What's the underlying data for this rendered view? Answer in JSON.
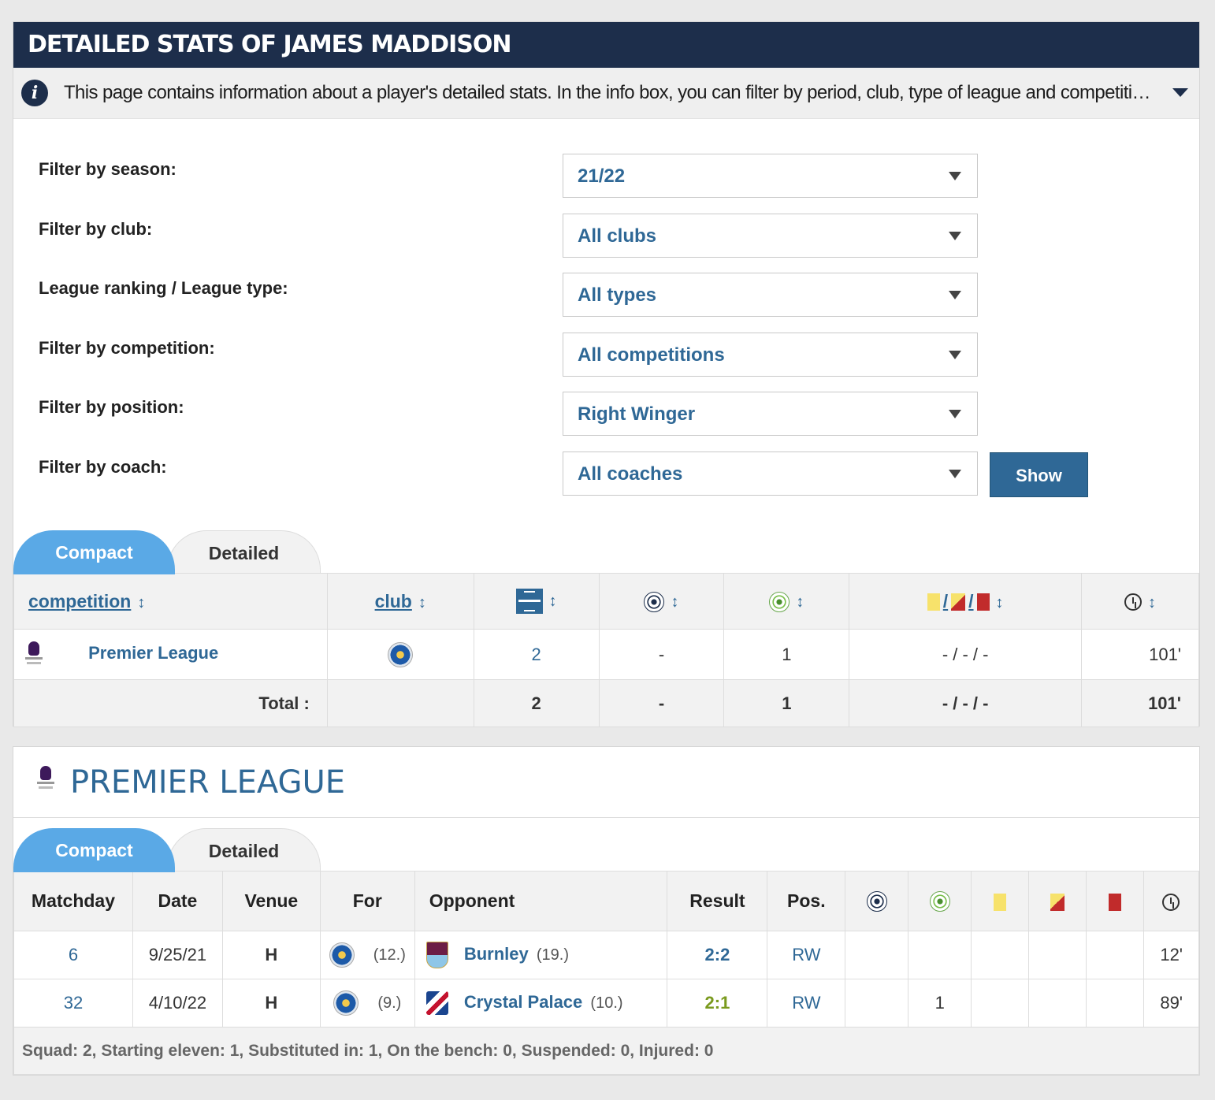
{
  "header": {
    "title": "DETAILED STATS OF JAMES MADDISON"
  },
  "info": {
    "text": "This page contains information about a player's detailed stats. In the info box, you can filter by period, club, type of league and competition. Th..."
  },
  "filters": [
    {
      "label": "Filter by season:",
      "value": "21/22"
    },
    {
      "label": "Filter by club:",
      "value": "All clubs"
    },
    {
      "label": "League ranking / League type:",
      "value": "All types"
    },
    {
      "label": "Filter by competition:",
      "value": "All competitions"
    },
    {
      "label": "Filter by position:",
      "value": "Right Winger"
    },
    {
      "label": "Filter by coach:",
      "value": "All coaches"
    }
  ],
  "show_button": "Show",
  "tabs": {
    "compact": "Compact",
    "detailed": "Detailed"
  },
  "summary_table": {
    "headers": {
      "competition": "competition",
      "club": "club",
      "sort": "↕"
    },
    "row": {
      "competition": "Premier League",
      "apps": "2",
      "goals": "-",
      "assists": "1",
      "cards": "- / - / -",
      "minutes": "101'"
    },
    "total": {
      "label": "Total :",
      "apps": "2",
      "goals": "-",
      "assists": "1",
      "cards": "- / - / -",
      "minutes": "101'"
    }
  },
  "section": {
    "title": "PREMIER LEAGUE"
  },
  "match_table": {
    "headers": {
      "matchday": "Matchday",
      "date": "Date",
      "venue": "Venue",
      "for": "For",
      "opponent": "Opponent",
      "result": "Result",
      "pos": "Pos."
    },
    "rows": [
      {
        "matchday": "6",
        "date": "9/25/21",
        "venue": "H",
        "for_rank": "(12.)",
        "opponent": "Burnley",
        "opp_rank": "(19.)",
        "result": "2:2",
        "pos": "RW",
        "goals": "",
        "assists": "",
        "yellow": "",
        "yellowred": "",
        "red": "",
        "minutes": "12'"
      },
      {
        "matchday": "32",
        "date": "4/10/22",
        "venue": "H",
        "for_rank": "(9.)",
        "opponent": "Crystal Palace",
        "opp_rank": "(10.)",
        "result": "2:1",
        "pos": "RW",
        "goals": "",
        "assists": "1",
        "yellow": "",
        "yellowred": "",
        "red": "",
        "minutes": "89'"
      }
    ],
    "footer": "Squad: 2, Starting eleven: 1, Substituted in: 1, On the bench: 0, Suspended: 0, Injured: 0"
  },
  "colors": {
    "header_bg": "#1d2e4b",
    "accent": "#2f6896",
    "tab_active": "#5aa9e6",
    "draw_result": "#2f6896",
    "win_result": "#7a9a1e"
  }
}
